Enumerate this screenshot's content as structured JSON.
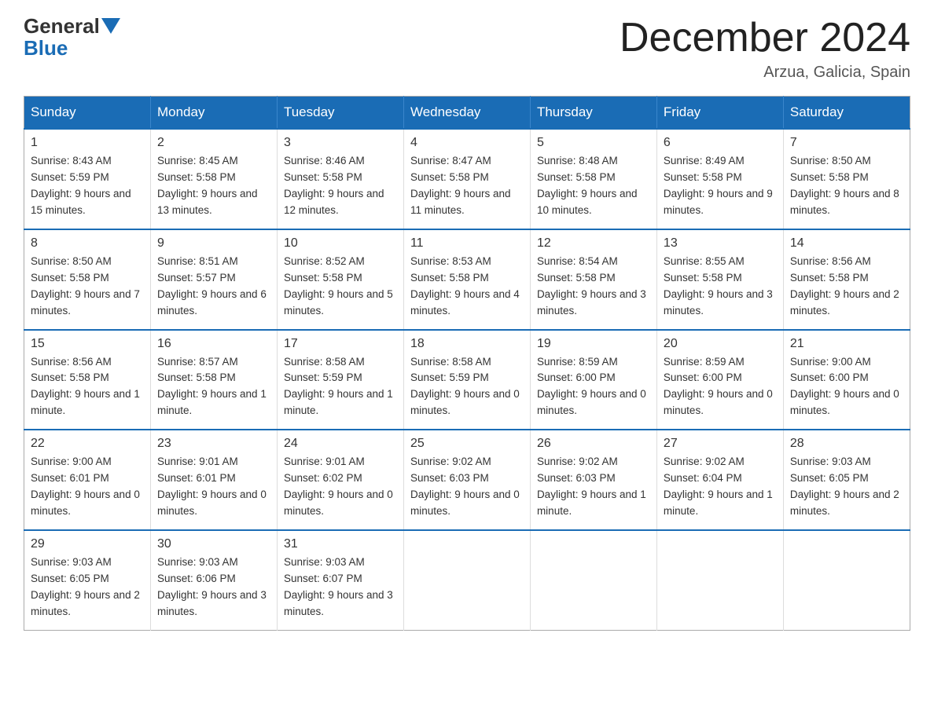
{
  "header": {
    "logo": {
      "general": "General",
      "blue": "Blue"
    },
    "title": "December 2024",
    "location": "Arzua, Galicia, Spain"
  },
  "weekdays": [
    "Sunday",
    "Monday",
    "Tuesday",
    "Wednesday",
    "Thursday",
    "Friday",
    "Saturday"
  ],
  "weeks": [
    [
      {
        "day": "1",
        "sunrise": "8:43 AM",
        "sunset": "5:59 PM",
        "daylight": "9 hours and 15 minutes."
      },
      {
        "day": "2",
        "sunrise": "8:45 AM",
        "sunset": "5:58 PM",
        "daylight": "9 hours and 13 minutes."
      },
      {
        "day": "3",
        "sunrise": "8:46 AM",
        "sunset": "5:58 PM",
        "daylight": "9 hours and 12 minutes."
      },
      {
        "day": "4",
        "sunrise": "8:47 AM",
        "sunset": "5:58 PM",
        "daylight": "9 hours and 11 minutes."
      },
      {
        "day": "5",
        "sunrise": "8:48 AM",
        "sunset": "5:58 PM",
        "daylight": "9 hours and 10 minutes."
      },
      {
        "day": "6",
        "sunrise": "8:49 AM",
        "sunset": "5:58 PM",
        "daylight": "9 hours and 9 minutes."
      },
      {
        "day": "7",
        "sunrise": "8:50 AM",
        "sunset": "5:58 PM",
        "daylight": "9 hours and 8 minutes."
      }
    ],
    [
      {
        "day": "8",
        "sunrise": "8:50 AM",
        "sunset": "5:58 PM",
        "daylight": "9 hours and 7 minutes."
      },
      {
        "day": "9",
        "sunrise": "8:51 AM",
        "sunset": "5:57 PM",
        "daylight": "9 hours and 6 minutes."
      },
      {
        "day": "10",
        "sunrise": "8:52 AM",
        "sunset": "5:58 PM",
        "daylight": "9 hours and 5 minutes."
      },
      {
        "day": "11",
        "sunrise": "8:53 AM",
        "sunset": "5:58 PM",
        "daylight": "9 hours and 4 minutes."
      },
      {
        "day": "12",
        "sunrise": "8:54 AM",
        "sunset": "5:58 PM",
        "daylight": "9 hours and 3 minutes."
      },
      {
        "day": "13",
        "sunrise": "8:55 AM",
        "sunset": "5:58 PM",
        "daylight": "9 hours and 3 minutes."
      },
      {
        "day": "14",
        "sunrise": "8:56 AM",
        "sunset": "5:58 PM",
        "daylight": "9 hours and 2 minutes."
      }
    ],
    [
      {
        "day": "15",
        "sunrise": "8:56 AM",
        "sunset": "5:58 PM",
        "daylight": "9 hours and 1 minute."
      },
      {
        "day": "16",
        "sunrise": "8:57 AM",
        "sunset": "5:58 PM",
        "daylight": "9 hours and 1 minute."
      },
      {
        "day": "17",
        "sunrise": "8:58 AM",
        "sunset": "5:59 PM",
        "daylight": "9 hours and 1 minute."
      },
      {
        "day": "18",
        "sunrise": "8:58 AM",
        "sunset": "5:59 PM",
        "daylight": "9 hours and 0 minutes."
      },
      {
        "day": "19",
        "sunrise": "8:59 AM",
        "sunset": "6:00 PM",
        "daylight": "9 hours and 0 minutes."
      },
      {
        "day": "20",
        "sunrise": "8:59 AM",
        "sunset": "6:00 PM",
        "daylight": "9 hours and 0 minutes."
      },
      {
        "day": "21",
        "sunrise": "9:00 AM",
        "sunset": "6:00 PM",
        "daylight": "9 hours and 0 minutes."
      }
    ],
    [
      {
        "day": "22",
        "sunrise": "9:00 AM",
        "sunset": "6:01 PM",
        "daylight": "9 hours and 0 minutes."
      },
      {
        "day": "23",
        "sunrise": "9:01 AM",
        "sunset": "6:01 PM",
        "daylight": "9 hours and 0 minutes."
      },
      {
        "day": "24",
        "sunrise": "9:01 AM",
        "sunset": "6:02 PM",
        "daylight": "9 hours and 0 minutes."
      },
      {
        "day": "25",
        "sunrise": "9:02 AM",
        "sunset": "6:03 PM",
        "daylight": "9 hours and 0 minutes."
      },
      {
        "day": "26",
        "sunrise": "9:02 AM",
        "sunset": "6:03 PM",
        "daylight": "9 hours and 1 minute."
      },
      {
        "day": "27",
        "sunrise": "9:02 AM",
        "sunset": "6:04 PM",
        "daylight": "9 hours and 1 minute."
      },
      {
        "day": "28",
        "sunrise": "9:03 AM",
        "sunset": "6:05 PM",
        "daylight": "9 hours and 2 minutes."
      }
    ],
    [
      {
        "day": "29",
        "sunrise": "9:03 AM",
        "sunset": "6:05 PM",
        "daylight": "9 hours and 2 minutes."
      },
      {
        "day": "30",
        "sunrise": "9:03 AM",
        "sunset": "6:06 PM",
        "daylight": "9 hours and 3 minutes."
      },
      {
        "day": "31",
        "sunrise": "9:03 AM",
        "sunset": "6:07 PM",
        "daylight": "9 hours and 3 minutes."
      },
      null,
      null,
      null,
      null
    ]
  ]
}
